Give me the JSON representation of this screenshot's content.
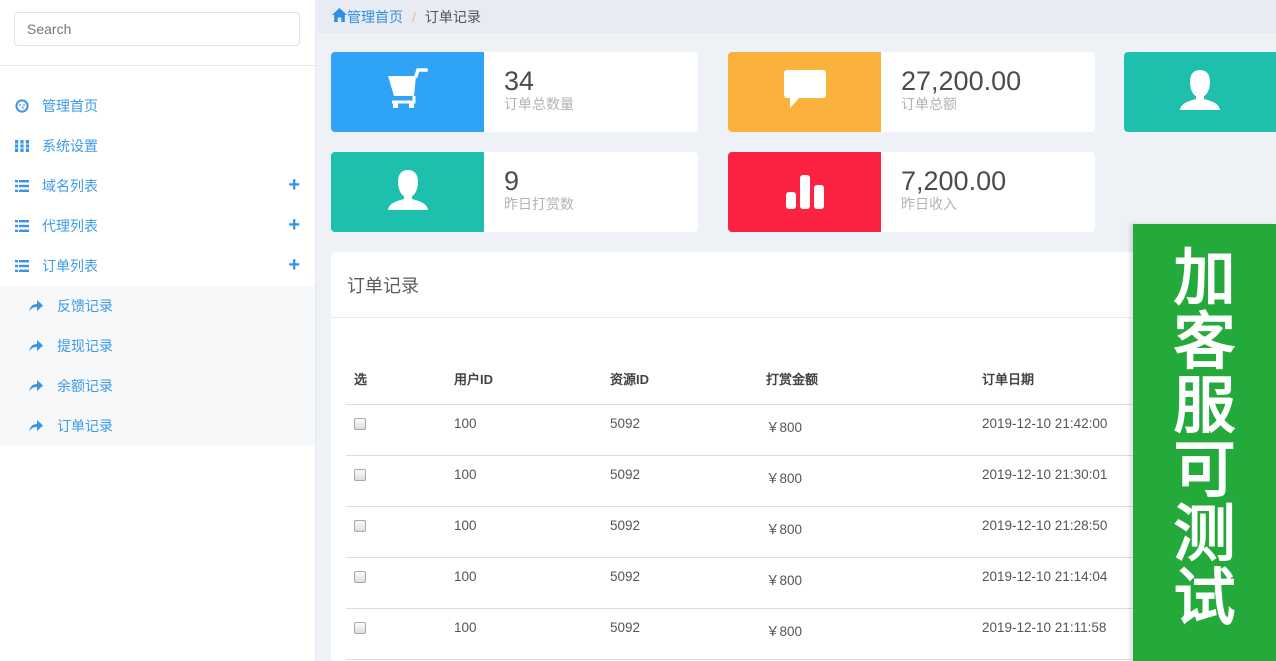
{
  "sidebar": {
    "search_placeholder": "Search",
    "menu": [
      {
        "label": "管理首页",
        "icon": "dashboard-icon",
        "expandable": false
      },
      {
        "label": "系统设置",
        "icon": "th-icon",
        "expandable": false
      },
      {
        "label": "域名列表",
        "icon": "list-icon",
        "expandable": true
      },
      {
        "label": "代理列表",
        "icon": "list-icon",
        "expandable": true
      },
      {
        "label": "订单列表",
        "icon": "list-icon",
        "expandable": true
      }
    ],
    "submenu": [
      {
        "label": "反馈记录",
        "icon": "share-icon"
      },
      {
        "label": "提现记录",
        "icon": "share-icon"
      },
      {
        "label": "余额记录",
        "icon": "share-icon"
      },
      {
        "label": "订单记录",
        "icon": "share-icon"
      }
    ],
    "expand_symbol": "+"
  },
  "breadcrumb": {
    "home": "管理首页",
    "separator": "/",
    "current": "订单记录"
  },
  "stats": [
    {
      "value": "34",
      "label": "订单总数量",
      "icon": "shopping-cart-icon",
      "color": "#2ea3f8"
    },
    {
      "value": "27,200.00",
      "label": "订单总额",
      "icon": "comment-icon",
      "color": "#fbb23c"
    },
    {
      "value": "",
      "label": "",
      "icon": "user-icon",
      "color": "#1fbfad"
    },
    {
      "value": "9",
      "label": "昨日打赏数",
      "icon": "user-icon",
      "color": "#1fbfad"
    },
    {
      "value": "7,200.00",
      "label": "昨日收入",
      "icon": "bar-chart-icon",
      "color": "#fb2242"
    }
  ],
  "panel": {
    "title": "订单记录",
    "columns": [
      "选",
      "用户ID",
      "资源ID",
      "打赏金额",
      "订单日期"
    ],
    "rows": [
      {
        "user_id": "100",
        "resource_id": "5092",
        "amount": "￥800",
        "date": "2019-12-10 21:42:00",
        "checked": false
      },
      {
        "user_id": "100",
        "resource_id": "5092",
        "amount": "￥800",
        "date": "2019-12-10 21:30:01",
        "checked": false
      },
      {
        "user_id": "100",
        "resource_id": "5092",
        "amount": "￥800",
        "date": "2019-12-10 21:28:50",
        "checked": false
      },
      {
        "user_id": "100",
        "resource_id": "5092",
        "amount": "￥800",
        "date": "2019-12-10 21:14:04",
        "checked": false
      },
      {
        "user_id": "100",
        "resource_id": "5092",
        "amount": "￥800",
        "date": "2019-12-10 21:11:58",
        "checked": false
      }
    ]
  },
  "banner": {
    "chars": [
      "加",
      "客",
      "服",
      "可",
      "测",
      "试"
    ],
    "color": "#24aa3b"
  }
}
